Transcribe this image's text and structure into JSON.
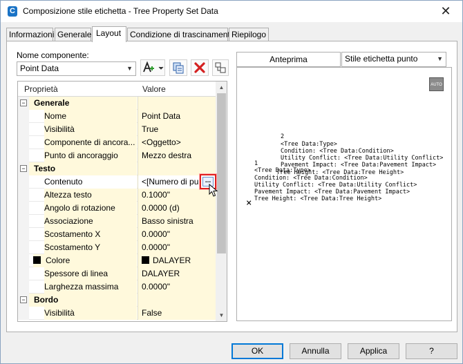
{
  "window": {
    "title": "Composizione stile etichetta - Tree Property Set Data",
    "close_glyph": "✕",
    "app_icon_glyph": "C"
  },
  "tabs": [
    {
      "label": "Informazioni"
    },
    {
      "label": "Generale"
    },
    {
      "label": "Layout"
    },
    {
      "label": "Condizione di trascinamento"
    },
    {
      "label": "Riepilogo"
    }
  ],
  "layout": {
    "component_name_label": "Nome componente:",
    "component_name_value": "Point Data",
    "grid_headers": {
      "property": "Proprietà",
      "value": "Valore"
    },
    "rows": [
      {
        "type": "cat",
        "name": "Generale",
        "value": "",
        "expander": "−"
      },
      {
        "type": "prop",
        "name": "Nome",
        "value": "Point Data"
      },
      {
        "type": "prop",
        "name": "Visibilità",
        "value": "True"
      },
      {
        "type": "prop",
        "name": "Componente di ancora...",
        "value": "<Oggetto>"
      },
      {
        "type": "prop",
        "name": "Punto di ancoraggio",
        "value": "Mezzo destra"
      },
      {
        "type": "cat",
        "name": "Testo",
        "value": "",
        "expander": "−"
      },
      {
        "type": "prop",
        "name": "Contenuto",
        "value": "<[Numero di pu...",
        "selected": true
      },
      {
        "type": "prop",
        "name": "Altezza testo",
        "value": "0.1000\""
      },
      {
        "type": "prop",
        "name": "Angolo di rotazione",
        "value": "0.0000 (d)"
      },
      {
        "type": "prop",
        "name": "Associazione",
        "value": "Basso sinistra"
      },
      {
        "type": "prop",
        "name": "Scostamento X",
        "value": "0.0000\""
      },
      {
        "type": "prop",
        "name": "Scostamento Y",
        "value": "0.0000\""
      },
      {
        "type": "prop",
        "name": "Colore",
        "value": "DALAYER",
        "swatch": true
      },
      {
        "type": "prop",
        "name": "Spessore di linea",
        "value": "DALAYER"
      },
      {
        "type": "prop",
        "name": "Larghezza massima",
        "value": "0.0000\""
      },
      {
        "type": "cat",
        "name": "Bordo",
        "value": "",
        "expander": "−"
      },
      {
        "type": "prop",
        "name": "Visibilità",
        "value": "False"
      }
    ],
    "ellipsis_label": "..."
  },
  "preview": {
    "tab_label": "Anteprima",
    "style_select": "Stile etichetta punto",
    "auto_badge": "AUTO",
    "labels": [
      "2",
      "<Tree Data:Type>",
      "Condition: <Tree Data:Condition>",
      "Utility Conflict: <Tree Data:Utility Conflict>",
      "Pavement Impact: <Tree Data:Pavement Impact>",
      "1",
      "<Tree Data:Type>",
      "Tree Height: <Tree Data:Tree Height>",
      "Condition: <Tree Data:Condition>",
      "Utility Conflict: <Tree Data:Utility Conflict>",
      "Pavement Impact: <Tree Data:Pavement Impact>",
      "Tree Height: <Tree Data:Tree Height>"
    ],
    "marker_glyph": "×"
  },
  "footer": {
    "ok": "OK",
    "cancel": "Annulla",
    "apply": "Applica",
    "help": "?"
  },
  "colors": {
    "property_bg": "#fff9dc",
    "highlight": "#e02020",
    "app_icon": "#1a73c6"
  }
}
